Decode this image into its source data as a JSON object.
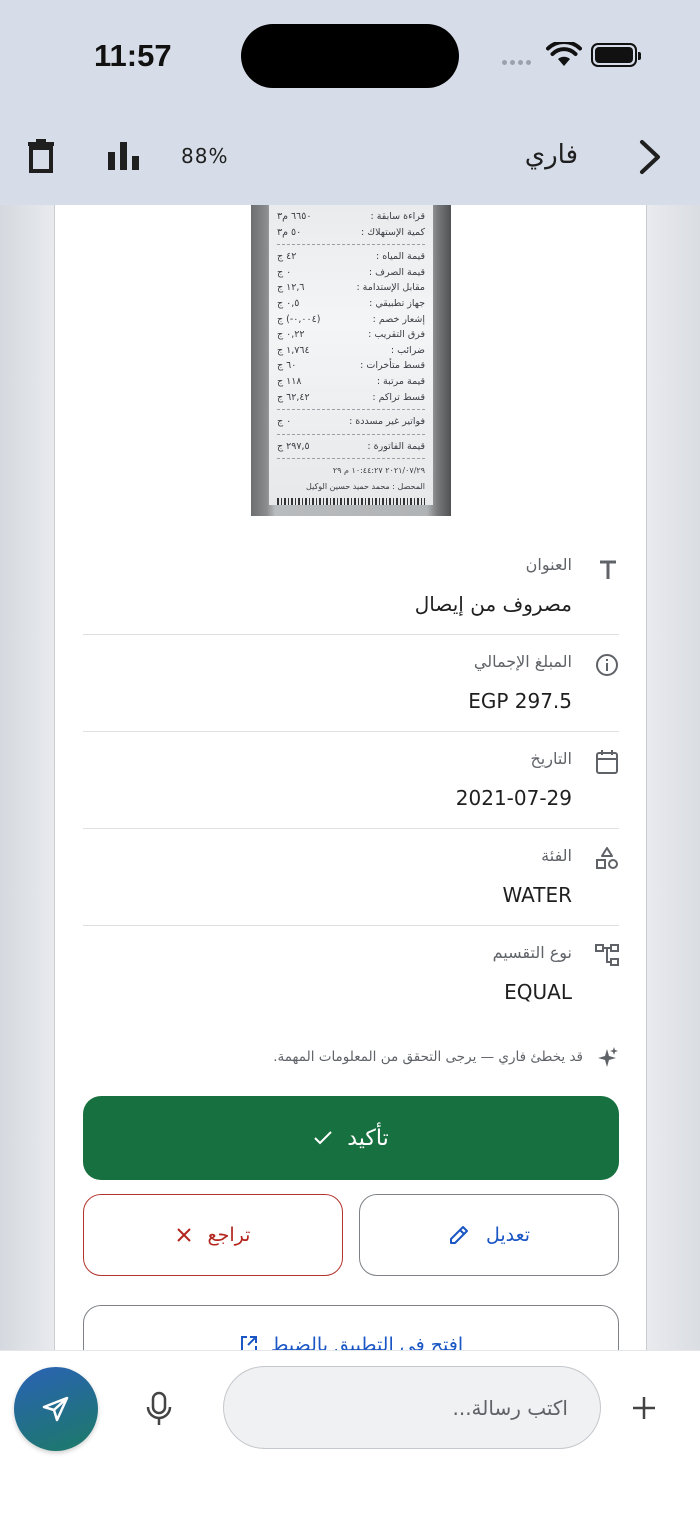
{
  "status_bar": {
    "time": "11:57"
  },
  "header": {
    "zoom": "88%",
    "chat_title": "فاري"
  },
  "receipt": {
    "lines_top": [
      {
        "label": "قراءة سابقة :",
        "value": "٦٦٥٠ م٣"
      },
      {
        "label": "كمية الإستهلاك :",
        "value": "٥٠ م٣"
      }
    ],
    "lines_mid": [
      {
        "label": "قيمة المياه :",
        "value": "٤٢ ج"
      },
      {
        "label": "قيمة الصرف :",
        "value": "٠ ج"
      },
      {
        "label": "مقابل الإستدامة :",
        "value": "١٢,٦ ج"
      },
      {
        "label": "جهاز تطبيقي :",
        "value": "٠,٥ ج"
      },
      {
        "label": "إشعار خصم :",
        "value": "(٠,٠٠٤-) ج"
      },
      {
        "label": "فرق التقريب :",
        "value": "٠,٢٢ ج"
      },
      {
        "label": "ضرائب :",
        "value": "١,٧٦٤ ج"
      },
      {
        "label": "قسط متأخرات :",
        "value": "٦٠ ج"
      },
      {
        "label": "قيمة مرتبة :",
        "value": "١١٨ ج"
      },
      {
        "label": "قسط تراكم :",
        "value": "٦٢,٤٢ ج"
      }
    ],
    "unpaid": {
      "label": "فواتير غير مسددة :",
      "value": "٠ ج"
    },
    "total": {
      "label": "قيمة الفاتورة :",
      "value": "٢٩٧,٥ ج"
    },
    "timestamp": "٢٠٢١/٠٧/٢٩ ١٠:٤٤:٢٧ م ٢٩",
    "collector": "المحصل : محمد حميد حسين الوكيل"
  },
  "fields": {
    "title": {
      "label": "العنوان",
      "value": "مصروف من إيصال"
    },
    "amount": {
      "label": "المبلغ الإجمالي",
      "value": "EGP 297.5"
    },
    "date": {
      "label": "التاريخ",
      "value": "2021-07-29"
    },
    "category": {
      "label": "الفئة",
      "value": "WATER"
    },
    "split": {
      "label": "نوع التقسيم",
      "value": "EQUAL"
    }
  },
  "disclaimer": "قد يخطئ فاري — يرجى التحقق من المعلومات المهمة.",
  "actions": {
    "confirm": "تأكيد",
    "edit": "تعديل",
    "undo": "تراجع",
    "open_app": "افتح في التطبيق بالضبط"
  },
  "composer": {
    "placeholder": "اكتب رسالة..."
  },
  "colors": {
    "confirm_green": "#17703f",
    "edit_blue": "#1a56c4",
    "undo_red": "#b3261e",
    "header_bg": "#d6dde8"
  }
}
